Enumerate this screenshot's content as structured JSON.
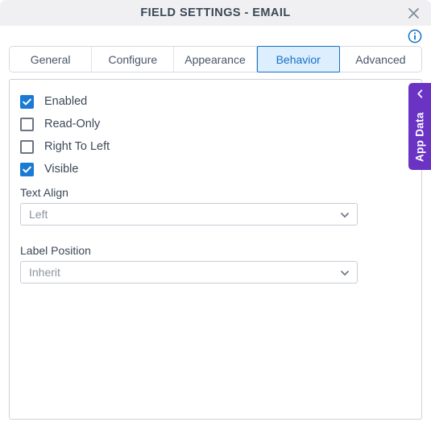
{
  "dialog": {
    "title": "FIELD SETTINGS - EMAIL",
    "close_label": "close-icon",
    "info_label": "info-icon",
    "accent_blue": "#1570c4",
    "checkbox_blue": "#1a7ad4",
    "titlebar_bg": "#f0f0f2",
    "active_tab_bg": "#ddeeff",
    "panel_border": "#ccd2da"
  },
  "tabs": [
    {
      "label": "General",
      "active": false
    },
    {
      "label": "Configure",
      "active": false
    },
    {
      "label": "Appearance",
      "active": false
    },
    {
      "label": "Behavior",
      "active": true
    },
    {
      "label": "Advanced",
      "active": false
    }
  ],
  "behavior": {
    "checkboxes": [
      {
        "label": "Enabled",
        "checked": true
      },
      {
        "label": "Read-Only",
        "checked": false
      },
      {
        "label": "Right To Left",
        "checked": false
      },
      {
        "label": "Visible",
        "checked": true
      }
    ],
    "fields": [
      {
        "label": "Text Align",
        "value": "Left"
      },
      {
        "label": "Label Position",
        "value": "Inherit"
      }
    ]
  },
  "app_data_panel": {
    "label": "App Data",
    "chevron": "chevron-left-icon",
    "color": "#6a33c4"
  }
}
